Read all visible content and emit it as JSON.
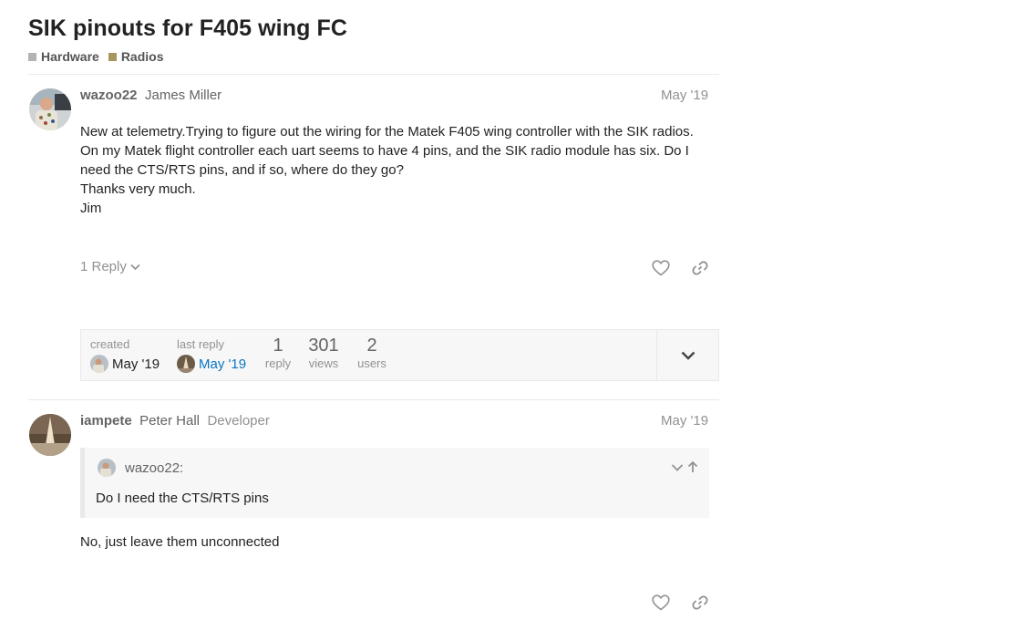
{
  "topic": {
    "title": "SIK pinouts for F405 wing FC",
    "categories": [
      {
        "label": "Hardware",
        "color": "#b3b3b3"
      },
      {
        "label": "Radios",
        "color": "#a99561"
      }
    ]
  },
  "post1": {
    "username": "wazoo22",
    "fullname": "James Miller",
    "date": "May '19",
    "lines": [
      "New at telemetry.Trying to figure out the wiring for the Matek F405 wing controller with the SIK radios.",
      "On my Matek flight controller each uart seems to have 4 pins, and the SIK radio module has six. Do I",
      "need the CTS/RTS pins, and if so, where do they go?",
      "Thanks very much.",
      "Jim"
    ],
    "replies_label": "1 Reply"
  },
  "topic_map": {
    "created_label": "created",
    "created_date": "May '19",
    "last_reply_label": "last reply",
    "last_reply_date": "May '19",
    "reply_count": "1",
    "reply_label": "reply",
    "views_count": "301",
    "views_label": "views",
    "users_count": "2",
    "users_label": "users"
  },
  "post2": {
    "username": "iampete",
    "fullname": "Peter Hall",
    "title": "Developer",
    "date": "May '19",
    "quote_author": "wazoo22:",
    "quote_text": "Do I need the CTS/RTS pins",
    "body": "No, just leave them unconnected"
  },
  "colors": {
    "link": "#0a74c2",
    "muted": "#919191",
    "border": "#e9e9e9"
  }
}
